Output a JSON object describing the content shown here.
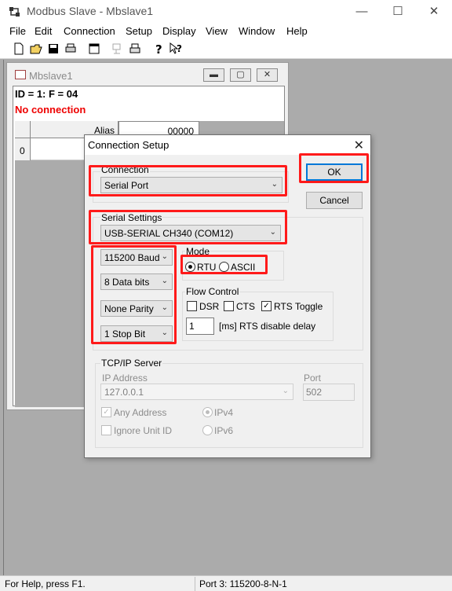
{
  "app": {
    "title": "Modbus Slave - Mbslave1",
    "icon": "modbus-slave-app-icon"
  },
  "menu": [
    "File",
    "Edit",
    "Connection",
    "Setup",
    "Display",
    "View",
    "Window",
    "Help"
  ],
  "toolbar": {
    "icons": [
      "new-document-icon",
      "open-folder-icon",
      "save-icon",
      "print-icon",
      "window-icon",
      "read-disabled-icon",
      "printer-alt-icon",
      "help-icon",
      "context-help-icon"
    ]
  },
  "child": {
    "title": "Mbslave1",
    "id_line": "ID = 1: F = 04",
    "status": "No connection",
    "grid": {
      "alias_header": "Alias",
      "value_header": "00000",
      "row_label": "0"
    }
  },
  "dialog": {
    "title": "Connection Setup",
    "connection_label": "Connection",
    "connection_value": "Serial Port",
    "ok_label": "OK",
    "cancel_label": "Cancel",
    "serial_settings_label": "Serial Settings",
    "port_value": "USB-SERIAL CH340 (COM12)",
    "baud_value": "115200 Baud",
    "data_bits_value": "8 Data bits",
    "parity_value": "None Parity",
    "stop_bit_value": "1 Stop Bit",
    "mode_label": "Mode",
    "mode_rtu": "RTU",
    "mode_ascii": "ASCII",
    "mode_selected": "RTU",
    "flow_control_label": "Flow Control",
    "dsr_label": "DSR",
    "cts_label": "CTS",
    "rts_toggle_label": "RTS Toggle",
    "rts_toggle_checked": true,
    "rts_delay_value": "1",
    "rts_delay_label": "[ms] RTS disable delay",
    "tcpip_label": "TCP/IP Server",
    "ip_address_label": "IP Address",
    "ip_address_value": "127.0.0.1",
    "port_label": "Port",
    "port_number": "502",
    "any_address_label": "Any Address",
    "ignore_unit_id_label": "Ignore Unit ID",
    "ipv4_label": "IPv4",
    "ipv6_label": "IPv6"
  },
  "statusbar": {
    "help_text": "For Help, press F1.",
    "port_text": "Port 3: 115200-8-N-1"
  },
  "colors": {
    "highlight": "#ff1a1a",
    "no_connection": "#ee0000",
    "default_button_border": "#0078d7"
  }
}
